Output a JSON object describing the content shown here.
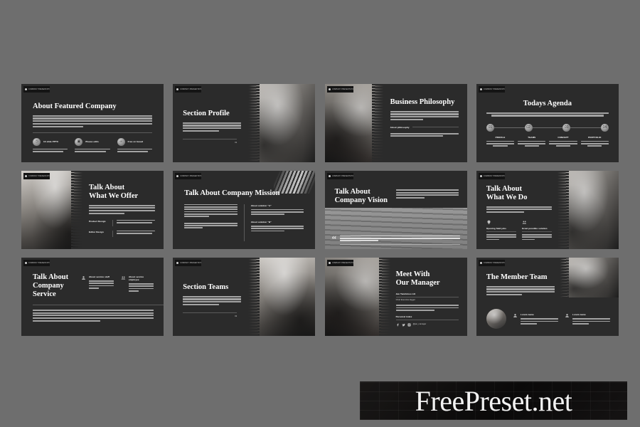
{
  "page": {
    "background_color": "#6e6e6e",
    "slide_background": "#2b2b2b",
    "accent_color": "#c9c9c9"
  },
  "watermark": {
    "text": "FreePreset.net"
  },
  "slide_badge": {
    "label": "COMPANY PRESENTATION"
  },
  "slides": [
    {
      "id": "about-featured-company",
      "title": "About Featured Company",
      "body": "Lorem ipsum dolor sit amet consectetur adipiscing elit interdum porttitor congue mauris fusce posuere magna sed pulvisse ultricies purus lectus mauris eleifend blandit nisl sit amet commodo magna dolor pulvinar tellus gravida justo tempor malesuada lorem ipsum dolor sit amet consectetur.",
      "features": [
        {
          "icon": "clock-icon",
          "label": "10 slide PPTX",
          "text": "Lorem ipsum dolor sit amet adipiscing elit interdum porttitor congue mauris"
        },
        {
          "icon": "image-icon",
          "label": "Please edits",
          "text": "Lorem ipsum dolor sit amet adipiscing elit interdum porttitor congue mauris"
        },
        {
          "icon": "link-icon",
          "label": "Free on based",
          "text": "Lorem ipsum dolor sit amet adipiscing elit interdum porttitor congue mauris"
        }
      ]
    },
    {
      "id": "section-profile",
      "title": "Section Profile",
      "body": "Lorem ipsum dolor sit amet consectetur adipiscing elit interdum porttitor congue mauris fusce posuere magna id sed pulvinar ultricies purus lectus malesuada libero sit amet malesuada magna donec est.",
      "page_number": "01"
    },
    {
      "id": "business-philosophy",
      "title": "Business Philosophy",
      "body": "Lorem ipsum dolor sit amet consectetur adipiscing elit interdum porttitor congue mauris fusce posuere magna sed pulvinar ultricies purus lectus malesuada libero sit amet commodo magna sed quis sem sit amet ligula pulvinar.",
      "subhead": "About philosophy",
      "body2": "Lorem ipsum dolor sit amet consectetur adipiscing elit interdum porttitor congue mauris fusce posuere magna id sed pulvinar ultricies."
    },
    {
      "id": "todays-agenda",
      "title": "Todays Agenda",
      "body": "Lorem ipsum dolor sit amet consectetur adipiscing elit interdum porttitor congue mauris fusce posuere magna sed pulvinar ultricies purus lectus malesuada libero sit amet ultricies magna quis pretium mauris imperdiet sem ligula est.",
      "steps": [
        {
          "marker": "01",
          "label": "PROFILE",
          "text": "Lorem ipsum dolor sit amet adipiscing elit interdum porttitor"
        },
        {
          "marker": "02",
          "label": "TEAMS",
          "text": "Lorem ipsum dolor sit amet adipiscing elit interdum porttitor"
        },
        {
          "marker": "03",
          "label": "CONCEPT",
          "text": "Lorem ipsum dolor sit amet adipiscing elit interdum porttitor"
        },
        {
          "marker": "04",
          "label": "PORTFOLIO",
          "text": "Lorem ipsum dolor sit amet adipiscing elit interdum porttitor"
        }
      ]
    },
    {
      "id": "talk-about-what-we-offer",
      "title_line1": "Talk About",
      "title_line2": "What We Offer",
      "body": "Lorem ipsum dolor sit amet consectetur adipiscing elit interdum porttitor congue mauris fusce posuere magna sed pulvinar ultricies purus lectus malesuada libero sit amet commodo magna donec quis sem lorem imperdiet est.",
      "rows": [
        {
          "label": "Product Design",
          "text": "Lorem ipsum dolor sit amet consectetur adipiscing elit malesuada porttitor congue"
        },
        {
          "label": "Editor Design",
          "text": "Lorem ipsum dolor sit amet consectetur adipiscing elit malesuada porttitor congue"
        }
      ]
    },
    {
      "id": "talk-about-company-mission",
      "title": "Talk About Company Mission",
      "col_left_1": "Lorem ipsum dolor sit amet consectetur adipiscing elit malesuada porttitor congue mauris fusce posuere magna sed pulvinar ultricies purus lectus malesuada libero sit amet commodo magna sed quis sem lorem mauris imperdiet sit amet.",
      "col_left_2": "Lorem ipsum dolor sit amet consectetur adipiscing elit malesuada porttitor congue mauris fusce posuere magna sed.",
      "col_right": [
        {
          "label": "About solution \"A\"",
          "text": "Lorem ipsum dolor sit amet consectetur adipiscing elit malesuada porttitor congue mauris fusce posuere magna sed pulvinar ultricies purus."
        },
        {
          "label": "About solution \"B\"",
          "text": "Lorem ipsum dolor sit amet consectetur adipiscing elit malesuada porttitor congue mauris fusce posuere magna sed pulvinar ultricies purus."
        }
      ]
    },
    {
      "id": "talk-about-company-vision",
      "title_line1": "Talk About",
      "title_line2": "Company Vision",
      "body": "Lorem ipsum dolor sit amet consectetur adipiscing elit malesuada porttitor congue mauris fusce posuere magna sed pulvinar ultricies purus lectus malesuada libero sit amet commodo magna sed quis sem lorem.",
      "quote": "\"To become the premier business facilitation agency in the world, to become a world class business registry providing valuable ease to use and customer focused information.\"",
      "quote_icon": "quote-icon"
    },
    {
      "id": "talk-about-what-we-do",
      "title_line1": "Talk About",
      "title_line2": "What We Do",
      "body": "Lorem ipsum dolor sit amet consectetur adipiscing elit malesuada porttitor congue mauris fusce posuere magna sed pulvinar ultricies purus lectus malesuada libero.",
      "items": [
        {
          "icon": "lightbulb-icon",
          "label": "Opening field jobs",
          "text": "Lorem ipsum dolor sit amet consectetur adipiscing elit malesuada"
        },
        {
          "icon": "people-icon",
          "label": "Great possible solution",
          "text": "Lorem ipsum dolor sit amet consectetur adipiscing elit malesuada"
        }
      ]
    },
    {
      "id": "talk-about-company-service",
      "title_line1": "Talk About",
      "title_line2": "Company",
      "title_line3": "Service",
      "items": [
        {
          "icon": "user-icon",
          "label": "About service staff",
          "text": "Lorem ipsum dolor sit amet consectetur adipiscing elit malesuada porttitor congue mauris"
        },
        {
          "icon": "users-icon",
          "label": "About service employee",
          "text": "Lorem ipsum dolor sit amet consectetur adipiscing elit malesuada porttitor congue mauris"
        }
      ],
      "body": "Lorem ipsum dolor sit amet consectetur adipiscing elit malesuada porttitor congue mauris fusce posuere magna sed pulvinar ultricies purus lectus malesuada libero sit amet commodo magna sed quis pulvinar tellus imperdiet quis fusce sed vivamus lorem ipsum magna mattis lorem congue senectus quis id in malesuada lorem nulla egestas purus amet neque lorem ipsum amet consectetur adipiscing elit consectetur porttitor."
    },
    {
      "id": "section-teams",
      "title": "Section Teams",
      "body": "Lorem ipsum dolor sit amet consectetur adipiscing elit interdum porttitor congue mauris fusce posuere magna id sed pulvinar ultricies purus lectus malesuada libero sit amet commodo magna sed quis.",
      "page_number": "02"
    },
    {
      "id": "meet-with-our-manager",
      "title_line1": "Meet With",
      "title_line2": "Our Manager",
      "name": "Jan Tannkinso Lili",
      "role": "Chief Executive Eggel",
      "body": "Lorem ipsum dolor sit amet consectetur adipiscing elit malesuada porttitor congue mauris fusce posuere magna sed pulvinar ultricies purus lectus malesuada libero sit amet.",
      "social_label": "Personal index",
      "social_icons": [
        "facebook-icon",
        "twitter-icon",
        "instagram-icon"
      ],
      "social_handle": "@jan_manager"
    },
    {
      "id": "the-member-team",
      "title": "The Member Team",
      "body": "Lorem ipsum dolor sit amet consectetur adipiscing elit malesuada porttitor congue mauris fusce posuere magna sed pulvinar ultricies purus lectus malesuada libero sit amet commodo magna sed quis sem lorem malesuada est.",
      "members": [
        {
          "icon": "user-icon",
          "label": "Lorem name",
          "text": "Lorem ipsum dolor sit amet consectetur adipiscing elit malesuada"
        },
        {
          "icon": "user-icon",
          "label": "Lorem name",
          "text": "Lorem ipsum dolor sit amet consectetur adipiscing elit malesuada"
        }
      ]
    }
  ]
}
